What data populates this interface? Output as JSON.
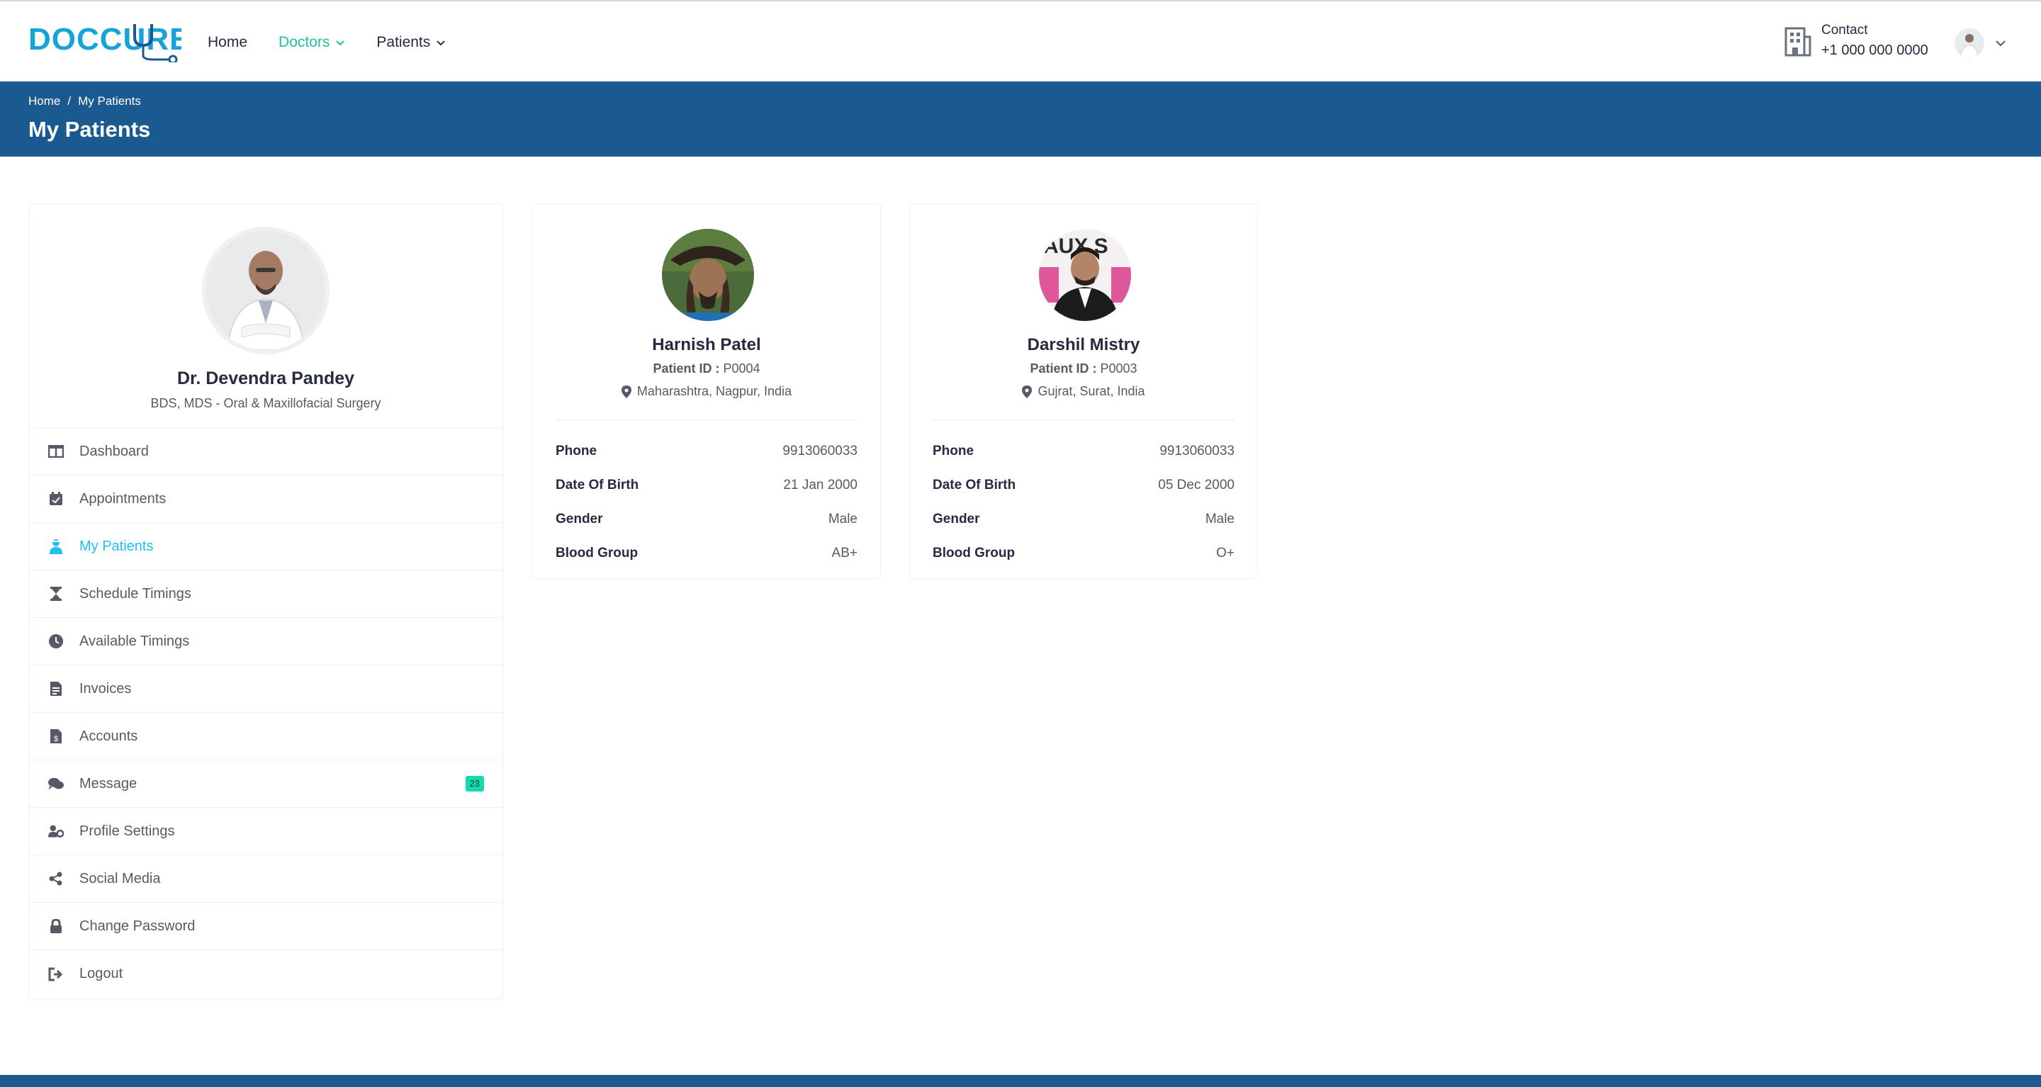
{
  "brand": {
    "name": "DOCCURE",
    "accent": "#15a3d8"
  },
  "nav": {
    "items": [
      {
        "label": "Home",
        "active": false,
        "has_dropdown": false
      },
      {
        "label": "Doctors",
        "active": true,
        "has_dropdown": true
      },
      {
        "label": "Patients",
        "active": false,
        "has_dropdown": true
      }
    ]
  },
  "header": {
    "contact_label": "Contact",
    "contact_phone": "+1 000 000 0000",
    "contact_icon": "building-icon"
  },
  "breadcrumb": {
    "home": "Home",
    "separator": "/",
    "current": "My Patients"
  },
  "page": {
    "title": "My Patients"
  },
  "doctor": {
    "name": "Dr. Devendra Pandey",
    "specialty": "BDS, MDS - Oral & Maxillofacial Surgery"
  },
  "sidebar": {
    "items": [
      {
        "label": "Dashboard",
        "icon": "columns-icon",
        "active": false
      },
      {
        "label": "Appointments",
        "icon": "calendar-check-icon",
        "active": false
      },
      {
        "label": "My Patients",
        "icon": "user-injured-icon",
        "active": true
      },
      {
        "label": "Schedule Timings",
        "icon": "hourglass-icon",
        "active": false
      },
      {
        "label": "Available Timings",
        "icon": "clock-icon",
        "active": false
      },
      {
        "label": "Invoices",
        "icon": "file-invoice-icon",
        "active": false
      },
      {
        "label": "Accounts",
        "icon": "file-dollar-icon",
        "active": false
      },
      {
        "label": "Message",
        "icon": "comments-icon",
        "active": false,
        "badge": "23"
      },
      {
        "label": "Profile Settings",
        "icon": "user-cog-icon",
        "active": false
      },
      {
        "label": "Social Media",
        "icon": "share-icon",
        "active": false
      },
      {
        "label": "Change Password",
        "icon": "lock-icon",
        "active": false
      },
      {
        "label": "Logout",
        "icon": "sign-out-icon",
        "active": false
      }
    ]
  },
  "patients": [
    {
      "name": "Harnish Patel",
      "id_label": "Patient ID :",
      "id": "P0004",
      "location": "Maharashtra, Nagpur, India",
      "fields": [
        {
          "label": "Phone",
          "value": "9913060033"
        },
        {
          "label": "Date Of Birth",
          "value": "21 Jan 2000"
        },
        {
          "label": "Gender",
          "value": "Male"
        },
        {
          "label": "Blood Group",
          "value": "AB+"
        }
      ]
    },
    {
      "name": "Darshil Mistry",
      "id_label": "Patient ID :",
      "id": "P0003",
      "location": "Gujrat, Surat, India",
      "fields": [
        {
          "label": "Phone",
          "value": "9913060033"
        },
        {
          "label": "Date Of Birth",
          "value": "05 Dec 2000"
        },
        {
          "label": "Gender",
          "value": "Male"
        },
        {
          "label": "Blood Group",
          "value": "O+"
        }
      ]
    }
  ],
  "colors": {
    "primary_blue": "#1b5a90",
    "active_cyan": "#20c0f3",
    "nav_active_green": "#20c0a0",
    "badge_green": "#14d9a8"
  }
}
